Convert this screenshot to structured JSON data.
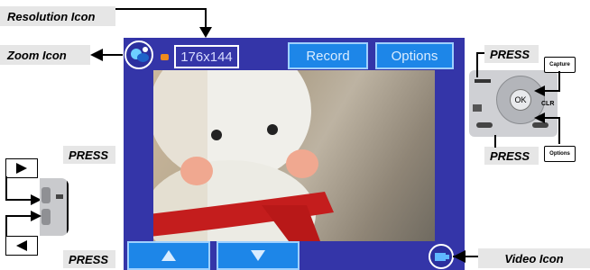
{
  "labels": {
    "resolution_icon": "Resolution Icon",
    "zoom_icon": "Zoom Icon",
    "video_icon": "Video Icon"
  },
  "press": {
    "top_right": "PRESS",
    "bottom_right": "PRESS",
    "left_top": "PRESS",
    "left_bottom": "PRESS"
  },
  "screen": {
    "resolution": "176x144",
    "record_label": "Record",
    "options_label": "Options"
  },
  "keys": {
    "capture": "Capture",
    "options": "Options",
    "ok": "OK",
    "clr": "CLR"
  },
  "icons": {
    "play": "right-triangle",
    "back": "left-triangle",
    "up": "up-triangle",
    "down": "down-triangle",
    "zoom": "zoom-icon",
    "video": "video-icon"
  }
}
